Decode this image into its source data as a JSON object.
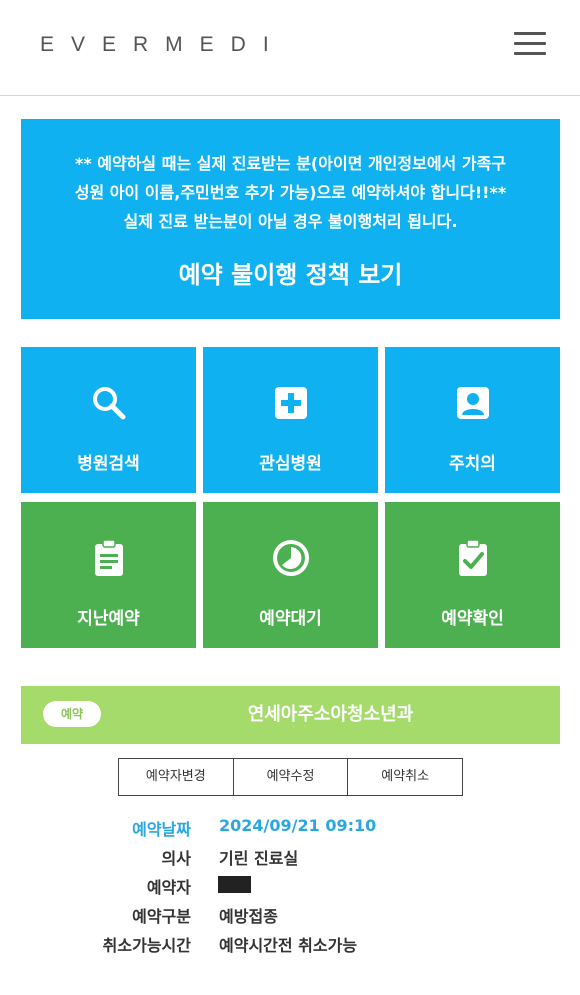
{
  "header": {
    "logo": "EVERMEDI"
  },
  "notice": {
    "lines": [
      "** 예약하실 때는 실제 진료받는 분(아이면 개인정보에서 가족구",
      "성원 아이 이름,주민번호 추가 가능)으로 예약하셔야 합니다!!**",
      "실제 진료 받는분이 아닐 경우 불이행처리 됩니다."
    ],
    "link": "예약 불이행 정책 보기"
  },
  "tiles": [
    {
      "label": "병원검색",
      "icon": "search-icon",
      "color": "#0fb1f0"
    },
    {
      "label": "관심병원",
      "icon": "medical-cross-icon",
      "color": "#0fb1f0"
    },
    {
      "label": "주치의",
      "icon": "doctor-portrait-icon",
      "color": "#0fb1f0"
    },
    {
      "label": "지난예약",
      "icon": "clipboard-icon",
      "color": "#4cb050"
    },
    {
      "label": "예약대기",
      "icon": "clock-icon",
      "color": "#4cb050"
    },
    {
      "label": "예약확인",
      "icon": "clipboard-check-icon",
      "color": "#4cb050"
    }
  ],
  "appointment": {
    "badge": "예약",
    "hospital": "연세아주소아청소년과",
    "actions": [
      "예약자변경",
      "예약수정",
      "예약취소"
    ],
    "details": [
      {
        "label": "예약날짜",
        "value": "2024/09/21 09:10"
      },
      {
        "label": "의사",
        "value": "기린 진료실"
      },
      {
        "label": "예약자",
        "value": ""
      },
      {
        "label": "예약구분",
        "value": "예방접종"
      },
      {
        "label": "취소가능시간",
        "value": "예약시간전 취소가능"
      }
    ]
  },
  "colors": {
    "blue": "#0fb1f0",
    "green": "#4cb050",
    "light_green": "#a4db6b",
    "highlight": "#2aa7e0"
  }
}
